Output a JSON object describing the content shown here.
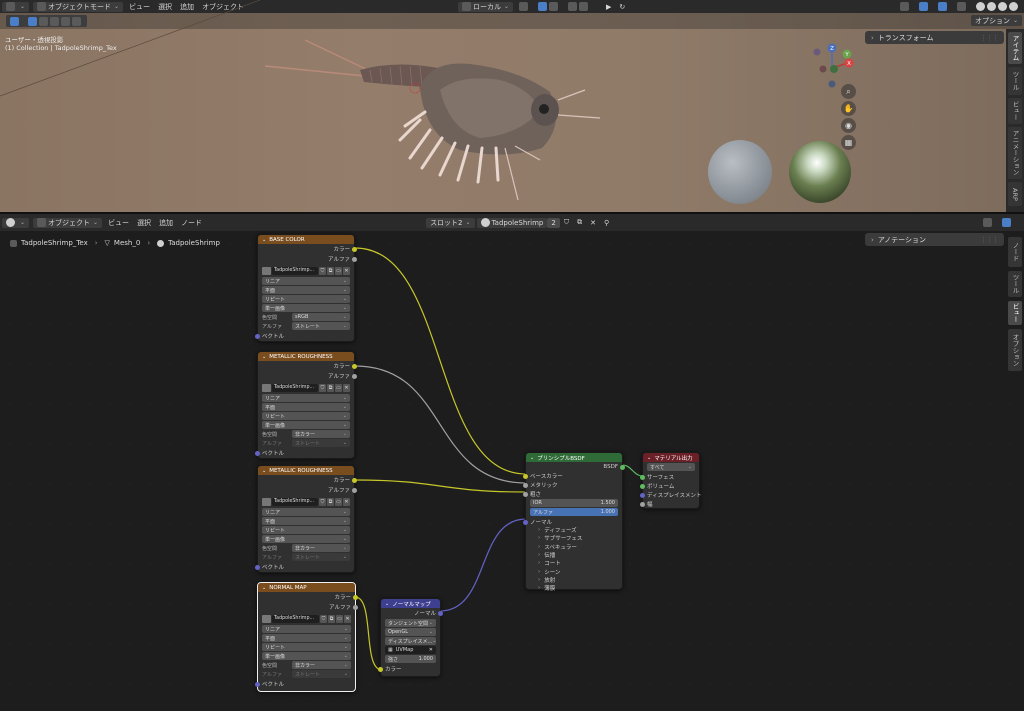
{
  "viewport": {
    "mode": "オブジェクトモード",
    "menus": [
      "ビュー",
      "選択",
      "追加",
      "オブジェクト"
    ],
    "transform_orientation": "ローカル",
    "options_label": "オプション",
    "view_name": "ユーザー・透視投影",
    "collection_label": "(1) Collection | TadpoleShrimp_Tex",
    "transform_panel": "トランスフォーム",
    "side_tabs": [
      "アイテム",
      "ツール",
      "ビュー",
      "アニメーション",
      "ARP"
    ],
    "gizmo": {
      "z": "Z",
      "y": "Y",
      "x": "X"
    }
  },
  "editor": {
    "editor_mode": "オブジェクト",
    "menus": [
      "ビュー",
      "選択",
      "追加",
      "ノード"
    ],
    "slot": "スロット2",
    "material_name": "TadpoleShrimp",
    "user_count": "2",
    "breadcrumb": [
      "TadpoleShrimp_Tex",
      "Mesh_0",
      "TadpoleShrimp"
    ],
    "annotation_panel": "アノテーション",
    "side_tabs": [
      "ノード",
      "ツール",
      "ビュー",
      "オプション"
    ]
  },
  "tex_common": {
    "color_out": "カラー",
    "alpha_out": "アルファ",
    "vector_in": "ベクトル",
    "image_name": "TadpoleShrimp...",
    "interp": "リニア",
    "proj": "平面",
    "ext": "リピート",
    "source": "単一画像",
    "colorspace_label": "色空間",
    "alpha_label": "アルファ",
    "alpha_mode": "ストレート"
  },
  "nodes": {
    "base": {
      "title": "BASE COLOR",
      "colorspace": "sRGB"
    },
    "mr1": {
      "title": "METALLIC ROUGHNESS",
      "colorspace": "非カラー"
    },
    "mr2": {
      "title": "METALLIC ROUGHNESS",
      "colorspace": "非カラー"
    },
    "normal_tex": {
      "title": "NORMAL MAP",
      "colorspace": "非カラー"
    },
    "normal_map": {
      "title": "ノーマルマップ",
      "out": "ノーマル",
      "space": "タンジェント空間",
      "convention": "OpenGL",
      "displacement": "ディスプレイスメ...",
      "uvmap": "UVMap",
      "strength_label": "強さ",
      "strength_value": "1.000",
      "color_in": "カラー"
    },
    "bsdf": {
      "title": "プリンシプルBSDF",
      "out": "BSDF",
      "base_color": "ベースカラー",
      "metallic": "メタリック",
      "roughness": "粗さ",
      "ior_label": "IOR",
      "ior_value": "1.500",
      "alpha_label": "アルファ",
      "alpha_value": "1.000",
      "normal": "ノーマル",
      "panels": [
        "ディフューズ",
        "サブサーフェス",
        "スペキュラー",
        "伝播",
        "コート",
        "シーン",
        "放射",
        "薄膜"
      ]
    },
    "output": {
      "title": "マテリアル出力",
      "target": "すべて",
      "inputs": [
        "サーフェス",
        "ボリューム",
        "ディスプレイスメント",
        "幅"
      ]
    }
  },
  "colors": {
    "header_brown": "#7a4d1f",
    "header_green": "#2f6b37",
    "header_blue": "#3e3f8f",
    "header_red": "#6b2028",
    "link_yellow": "#c7c729",
    "link_grey": "#a1a1a1",
    "link_purple": "#6363c7",
    "link_green": "#5fbb5f"
  }
}
